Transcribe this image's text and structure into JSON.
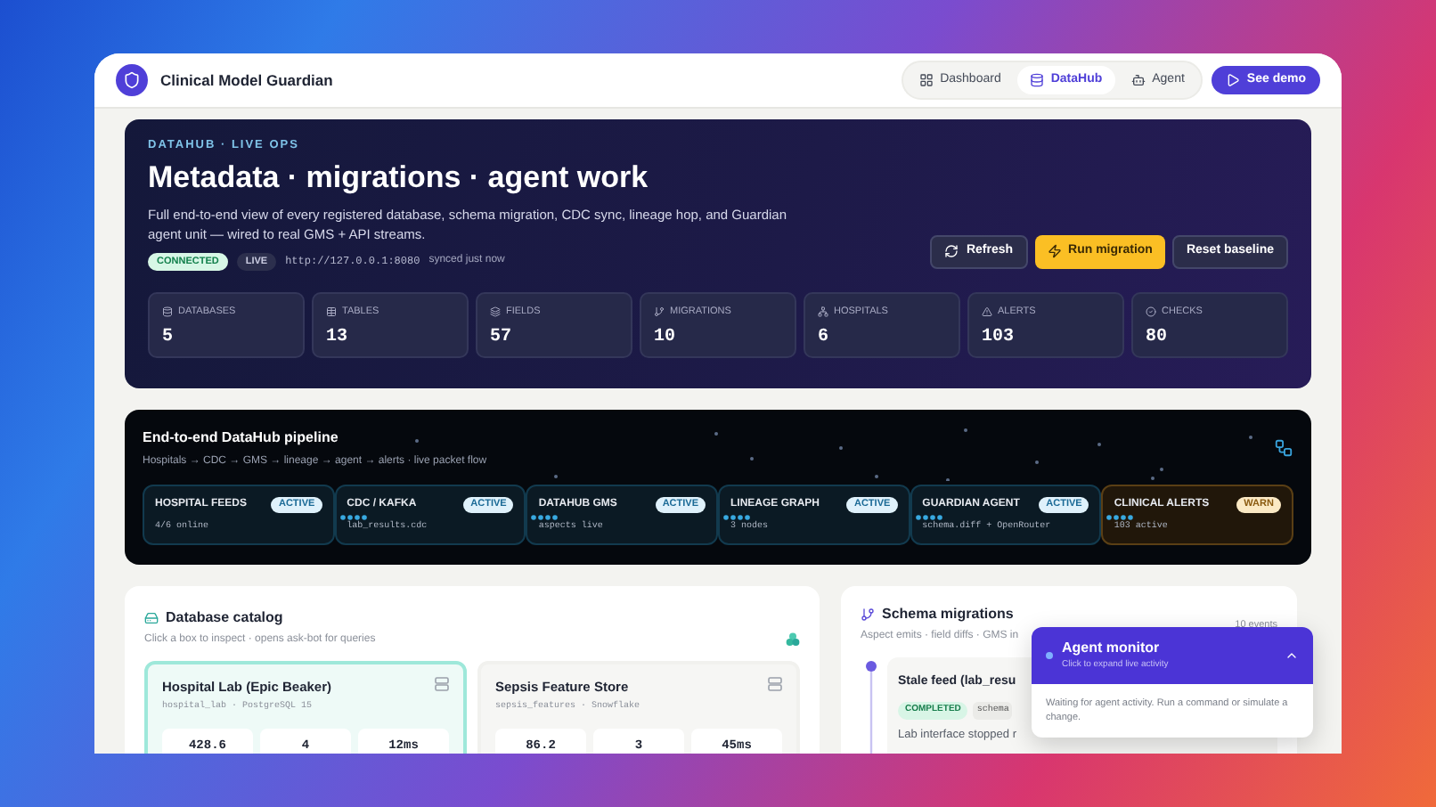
{
  "app": {
    "title": "Clinical Model Guardian"
  },
  "nav": [
    {
      "label": "Dashboard",
      "selected": false
    },
    {
      "label": "DataHub",
      "selected": true
    },
    {
      "label": "Agent",
      "selected": false
    }
  ],
  "demo_button": {
    "label": "See demo"
  },
  "hero": {
    "eyebrow": "DATAHUB · LIVE OPS",
    "title": "Metadata · migrations · agent work",
    "description": "Full end-to-end view of every registered database, schema migration, CDC sync, lineage hop, and Guardian agent unit — wired to real GMS + API streams.",
    "badges": [
      {
        "label": "CONNECTED",
        "kind": "success"
      },
      {
        "label": "LIVE",
        "kind": "neutral"
      }
    ],
    "endpoint": "http://127.0.0.1:8080",
    "sync": "synced just now",
    "actions": [
      {
        "label": "Refresh",
        "kind": "secondary"
      },
      {
        "label": "Run migration",
        "kind": "primary"
      },
      {
        "label": "Reset baseline",
        "kind": "secondary"
      }
    ],
    "stats": [
      {
        "label": "DATABASES",
        "value": "5"
      },
      {
        "label": "TABLES",
        "value": "13"
      },
      {
        "label": "FIELDS",
        "value": "57"
      },
      {
        "label": "MIGRATIONS",
        "value": "10"
      },
      {
        "label": "HOSPITALS",
        "value": "6"
      },
      {
        "label": "ALERTS",
        "value": "103"
      },
      {
        "label": "CHECKS",
        "value": "80"
      }
    ]
  },
  "pipeline": {
    "title": "End-to-end DataHub pipeline",
    "subtitle": "Hospitals → CDC → GMS → lineage → agent → alerts · live packet flow",
    "nodes": [
      {
        "name": "HOSPITAL FEEDS",
        "status": "ACTIVE",
        "kind": "active",
        "detail": "4/6 online"
      },
      {
        "name": "CDC / KAFKA",
        "status": "ACTIVE",
        "kind": "active",
        "detail": "lab_results.cdc"
      },
      {
        "name": "DATAHUB GMS",
        "status": "ACTIVE",
        "kind": "active",
        "detail": "aspects live"
      },
      {
        "name": "LINEAGE GRAPH",
        "status": "ACTIVE",
        "kind": "active",
        "detail": "3 nodes"
      },
      {
        "name": "GUARDIAN AGENT",
        "status": "ACTIVE",
        "kind": "active",
        "detail": "schema.diff + OpenRouter"
      },
      {
        "name": "CLINICAL ALERTS",
        "status": "WARN",
        "kind": "warn",
        "detail": "103 active"
      }
    ]
  },
  "catalog": {
    "title": "Database catalog",
    "subtitle": "Click a box to inspect · opens ask-bot for queries",
    "databases": [
      {
        "name": "Hospital Lab (Epic Beaker)",
        "source": "hospital_lab · PostgreSQL 15",
        "selected": true,
        "metrics": [
          "428.6",
          "4",
          "12ms"
        ]
      },
      {
        "name": "Sepsis Feature Store",
        "source": "sepsis_features · Snowflake",
        "selected": false,
        "metrics": [
          "86.2",
          "3",
          "45ms"
        ]
      }
    ]
  },
  "migrations": {
    "title": "Schema migrations",
    "subtitle": "Aspect emits · field diffs · GMS in",
    "count": "10 events",
    "items": [
      {
        "title": "Stale feed (lab_resu",
        "status": "COMPLETED",
        "tag": "schema",
        "description": "Lab interface stopped r"
      }
    ]
  },
  "agent_monitor": {
    "title": "Agent monitor",
    "subtitle": "Click to expand live activity",
    "expanded": false,
    "message": "Waiting for agent activity. Run a command or simulate a change."
  }
}
